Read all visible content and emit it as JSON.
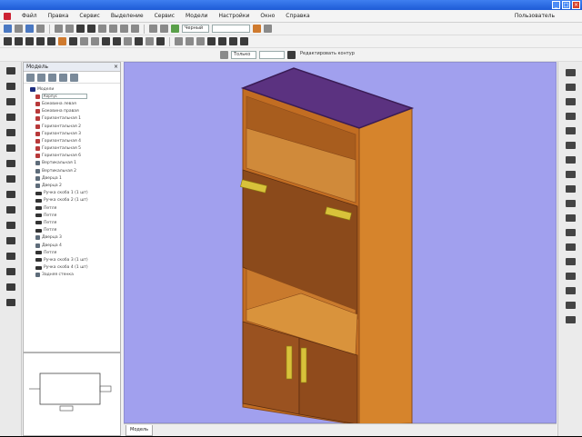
{
  "window": {
    "title": "",
    "controls": [
      "_",
      "□",
      "×"
    ]
  },
  "menu": {
    "items": [
      "Файл",
      "Правка",
      "Сервис",
      "Выделение",
      "Сервис",
      "Модели",
      "Настройки",
      "Окно",
      "Справка"
    ],
    "user": "Пользователь"
  },
  "toolbar": {
    "combo_color": "Черный",
    "combo_scale": "",
    "combo_mode": "Только",
    "snap_label": "Редактировать контур"
  },
  "panel": {
    "title": "Модель",
    "tree": [
      {
        "label": "Модели",
        "type": "root",
        "indent": 0
      },
      {
        "label": "Корпус",
        "type": "input",
        "indent": 1
      },
      {
        "label": "Боковина левая",
        "type": "red",
        "indent": 1
      },
      {
        "label": "Боковина правая",
        "type": "red",
        "indent": 1
      },
      {
        "label": "Горизонтальная 1",
        "type": "red",
        "indent": 1
      },
      {
        "label": "Горизонтальная 2",
        "type": "red",
        "indent": 1
      },
      {
        "label": "Горизонтальная 3",
        "type": "red",
        "indent": 1
      },
      {
        "label": "Горизонтальная 4",
        "type": "red",
        "indent": 1
      },
      {
        "label": "Горизонтальная 5",
        "type": "red",
        "indent": 1
      },
      {
        "label": "Горизонтальная 6",
        "type": "red",
        "indent": 1
      },
      {
        "label": "Вертикальная 1",
        "type": "gray",
        "indent": 1
      },
      {
        "label": "Вертикальная 2",
        "type": "gray",
        "indent": 1
      },
      {
        "label": "Дверца 1",
        "type": "gray",
        "indent": 1
      },
      {
        "label": "Дверца 2",
        "type": "gray",
        "indent": 1
      },
      {
        "label": "Ручка скоба 1 (1 шт)",
        "type": "blk",
        "indent": 1
      },
      {
        "label": "Ручка скоба 2 (1 шт)",
        "type": "blk",
        "indent": 1
      },
      {
        "label": "Петля",
        "type": "blk",
        "indent": 1
      },
      {
        "label": "Петля",
        "type": "blk",
        "indent": 1
      },
      {
        "label": "Петля",
        "type": "blk",
        "indent": 1
      },
      {
        "label": "Петля",
        "type": "blk",
        "indent": 1
      },
      {
        "label": "Дверца 3",
        "type": "gray",
        "indent": 1
      },
      {
        "label": "Дверца 4",
        "type": "gray",
        "indent": 1
      },
      {
        "label": "Петля",
        "type": "blk",
        "indent": 1
      },
      {
        "label": "Ручка скоба 3 (1 шт)",
        "type": "blk",
        "indent": 1
      },
      {
        "label": "Ручка скоба 4 (1 шт)",
        "type": "blk",
        "indent": 1
      },
      {
        "label": "Задняя стенка",
        "type": "gray",
        "indent": 1
      }
    ]
  },
  "viewport": {
    "background": "#a1a0ee",
    "tab_label": "Модель"
  },
  "colors": {
    "wood_front": "#c26d22",
    "wood_side": "#d6842c",
    "wood_dark": "#8a4a1a",
    "top": "#5b3280",
    "handle": "#d8c23a",
    "outline": "#3a1c55"
  }
}
